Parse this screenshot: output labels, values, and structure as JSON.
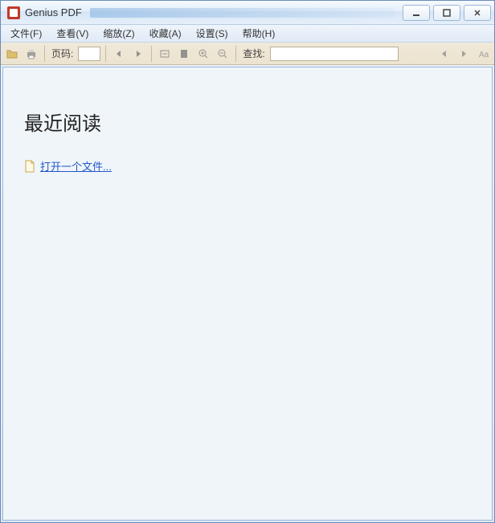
{
  "window": {
    "title": "Genius PDF"
  },
  "menus": {
    "file": "文件(F)",
    "view": "查看(V)",
    "zoom": "缩放(Z)",
    "favorites": "收藏(A)",
    "settings": "设置(S)",
    "help": "帮助(H)"
  },
  "toolbar": {
    "page_label": "页码:",
    "page_value": "",
    "find_label": "查找:",
    "find_value": ""
  },
  "content": {
    "recent_heading": "最近阅读",
    "open_file_label": "打开一个文件..."
  }
}
